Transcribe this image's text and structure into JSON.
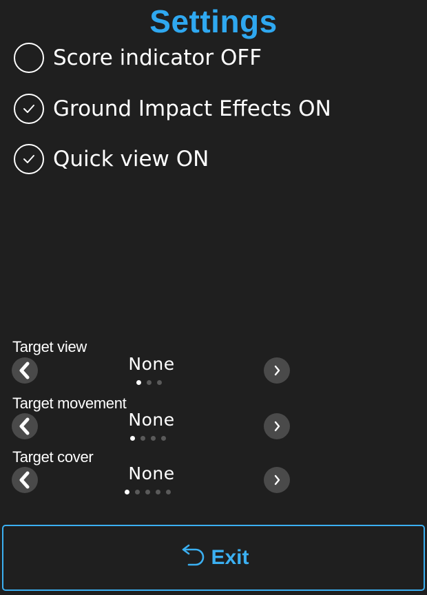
{
  "header": {
    "title": "Settings"
  },
  "toggles": [
    {
      "label": "Score indicator OFF",
      "checked": false
    },
    {
      "label": "Ground Impact Effects ON",
      "checked": true
    },
    {
      "label": "Quick view ON",
      "checked": true
    }
  ],
  "selectors": [
    {
      "label": "Target view",
      "value": "None",
      "pages": 3,
      "active_page": 1
    },
    {
      "label": "Target movement",
      "value": "None",
      "pages": 4,
      "active_page": 1
    },
    {
      "label": "Target cover",
      "value": "None",
      "pages": 5,
      "active_page": 1
    }
  ],
  "footer": {
    "exit_label": "Exit"
  },
  "icons": {
    "toggle_off": "empty-circle-icon",
    "toggle_on": "check-circle-icon",
    "prev": "chevron-left-icon",
    "next": "chevron-right-icon",
    "exit": "undo-arrow-icon"
  },
  "colors": {
    "background": "#1f1f1f",
    "title": "#2fa8f0",
    "accent": "#3bb0f2",
    "arrow_button": "#4a4a4a"
  }
}
